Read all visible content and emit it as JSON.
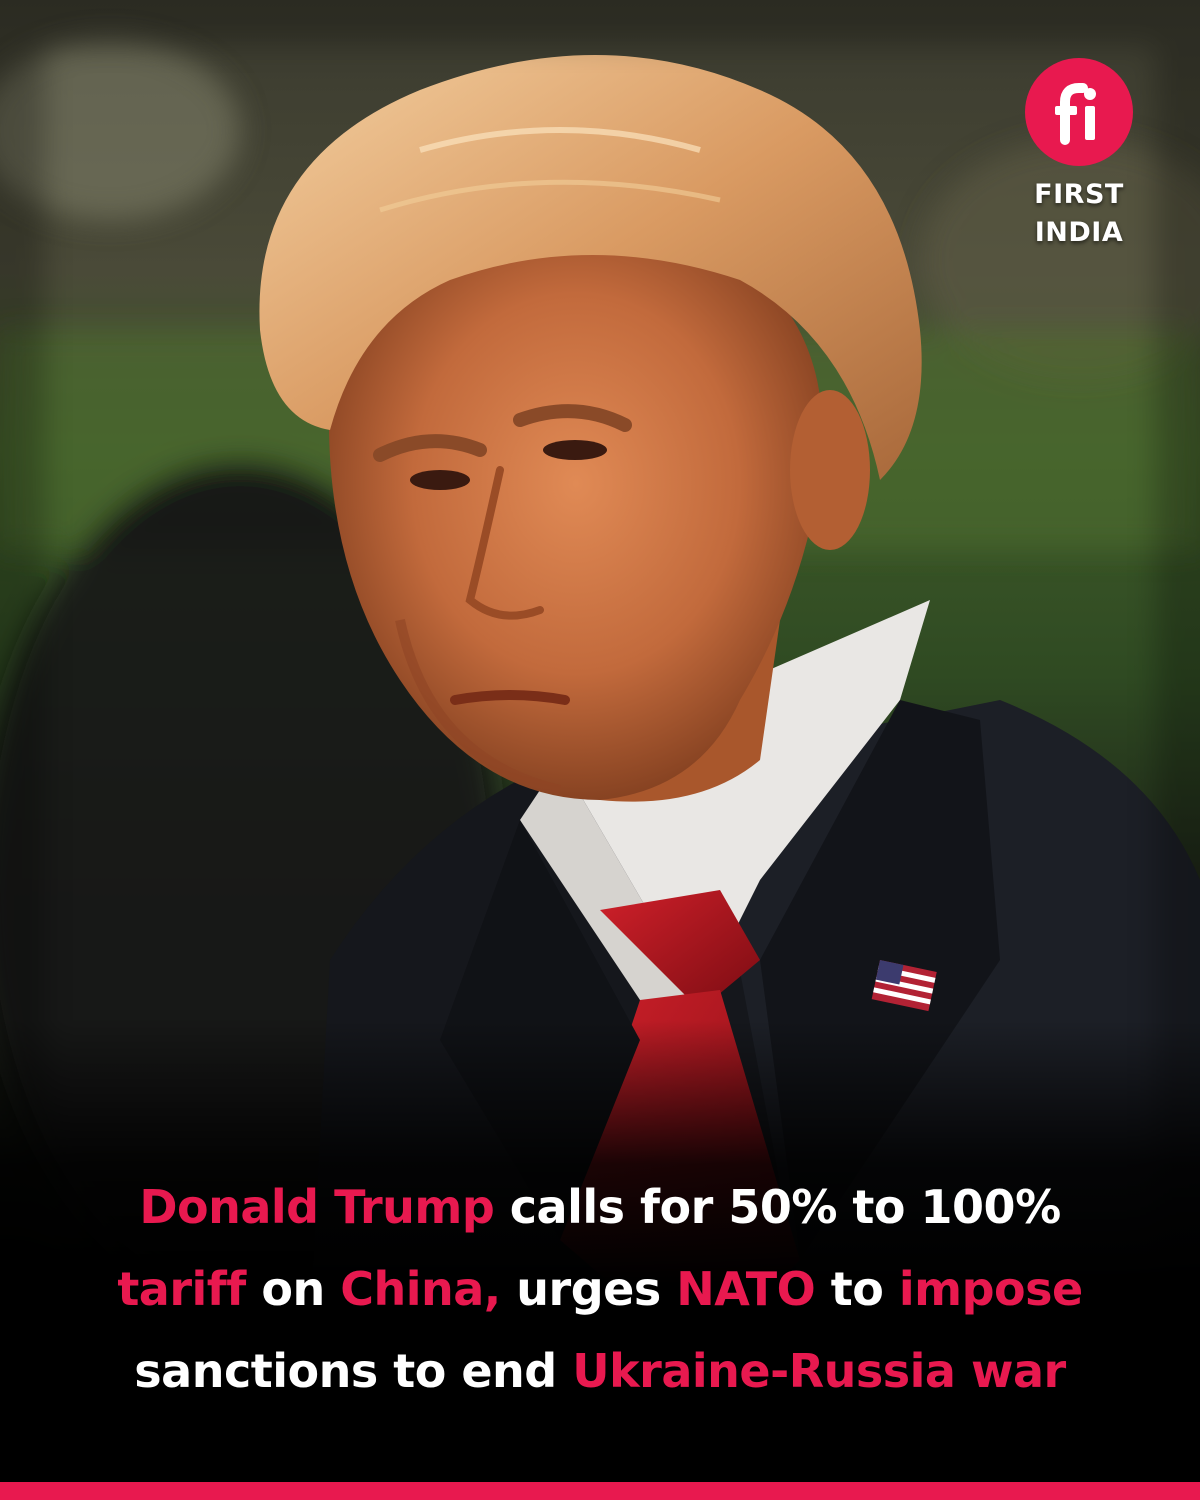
{
  "colors": {
    "accent": "#e8194f",
    "text": "#ffffff",
    "background": "#000000"
  },
  "image": {
    "description_icon": "portrait-photo"
  },
  "logo": {
    "icon": "fi-logo-icon",
    "line1": "FIRST",
    "line2": "INDIA"
  },
  "headline": {
    "line1": [
      {
        "text": "Donald Trump",
        "highlight": true
      },
      {
        "text": " calls for 50% to 100%",
        "highlight": false
      }
    ],
    "line2": [
      {
        "text": "tariff",
        "highlight": true
      },
      {
        "text": " on ",
        "highlight": false
      },
      {
        "text": "China,",
        "highlight": true
      },
      {
        "text": " urges ",
        "highlight": false
      },
      {
        "text": "NATO",
        "highlight": true
      },
      {
        "text": " to ",
        "highlight": false
      },
      {
        "text": "impose",
        "highlight": true
      }
    ],
    "line3": [
      {
        "text": "sanctions to end ",
        "highlight": false
      },
      {
        "text": "Ukraine-Russia war",
        "highlight": true
      }
    ]
  }
}
